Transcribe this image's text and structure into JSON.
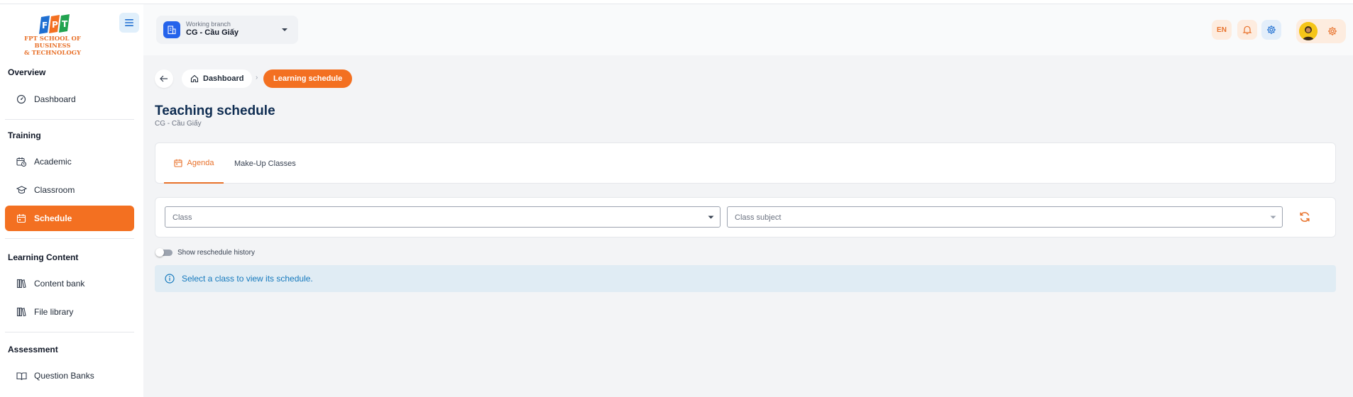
{
  "logo": {
    "text_line1": "FPT SCHOOL OF BUSINESS",
    "text_line2": "& TECHNOLOGY",
    "mark": "FPT"
  },
  "sidebar": {
    "sections": [
      {
        "title": "Overview",
        "items": [
          {
            "label": "Dashboard",
            "icon": "gauge-icon"
          }
        ]
      },
      {
        "title": "Training",
        "items": [
          {
            "label": "Academic",
            "icon": "calendar-clock-icon"
          },
          {
            "label": "Classroom",
            "icon": "graduation-cap-icon"
          },
          {
            "label": "Schedule",
            "icon": "calendar-icon",
            "active": true
          }
        ]
      },
      {
        "title": "Learning Content",
        "items": [
          {
            "label": "Content bank",
            "icon": "library-icon"
          },
          {
            "label": "File library",
            "icon": "library-icon"
          }
        ]
      },
      {
        "title": "Assessment",
        "items": [
          {
            "label": "Question Banks",
            "icon": "book-open-icon"
          }
        ]
      }
    ]
  },
  "header": {
    "branch_caption": "Working branch",
    "branch_value": "CG - Cầu Giấy",
    "language": "EN"
  },
  "breadcrumb": {
    "home": "Dashboard",
    "current": "Learning schedule"
  },
  "page": {
    "title": "Teaching schedule",
    "subtitle": "CG - Cầu Giấy"
  },
  "tabs": [
    {
      "label": "Agenda",
      "active": true
    },
    {
      "label": "Make-Up Classes",
      "active": false
    }
  ],
  "filters": {
    "class_placeholder": "Class",
    "subject_placeholder": "Class subject"
  },
  "toggle": {
    "label": "Show reschedule history",
    "on": false
  },
  "info": {
    "message": "Select a class to view its schedule."
  },
  "colors": {
    "accent": "#f37021",
    "title": "#0f2d52",
    "info_text": "#1579bd",
    "info_bg": "#e0ecf4"
  }
}
